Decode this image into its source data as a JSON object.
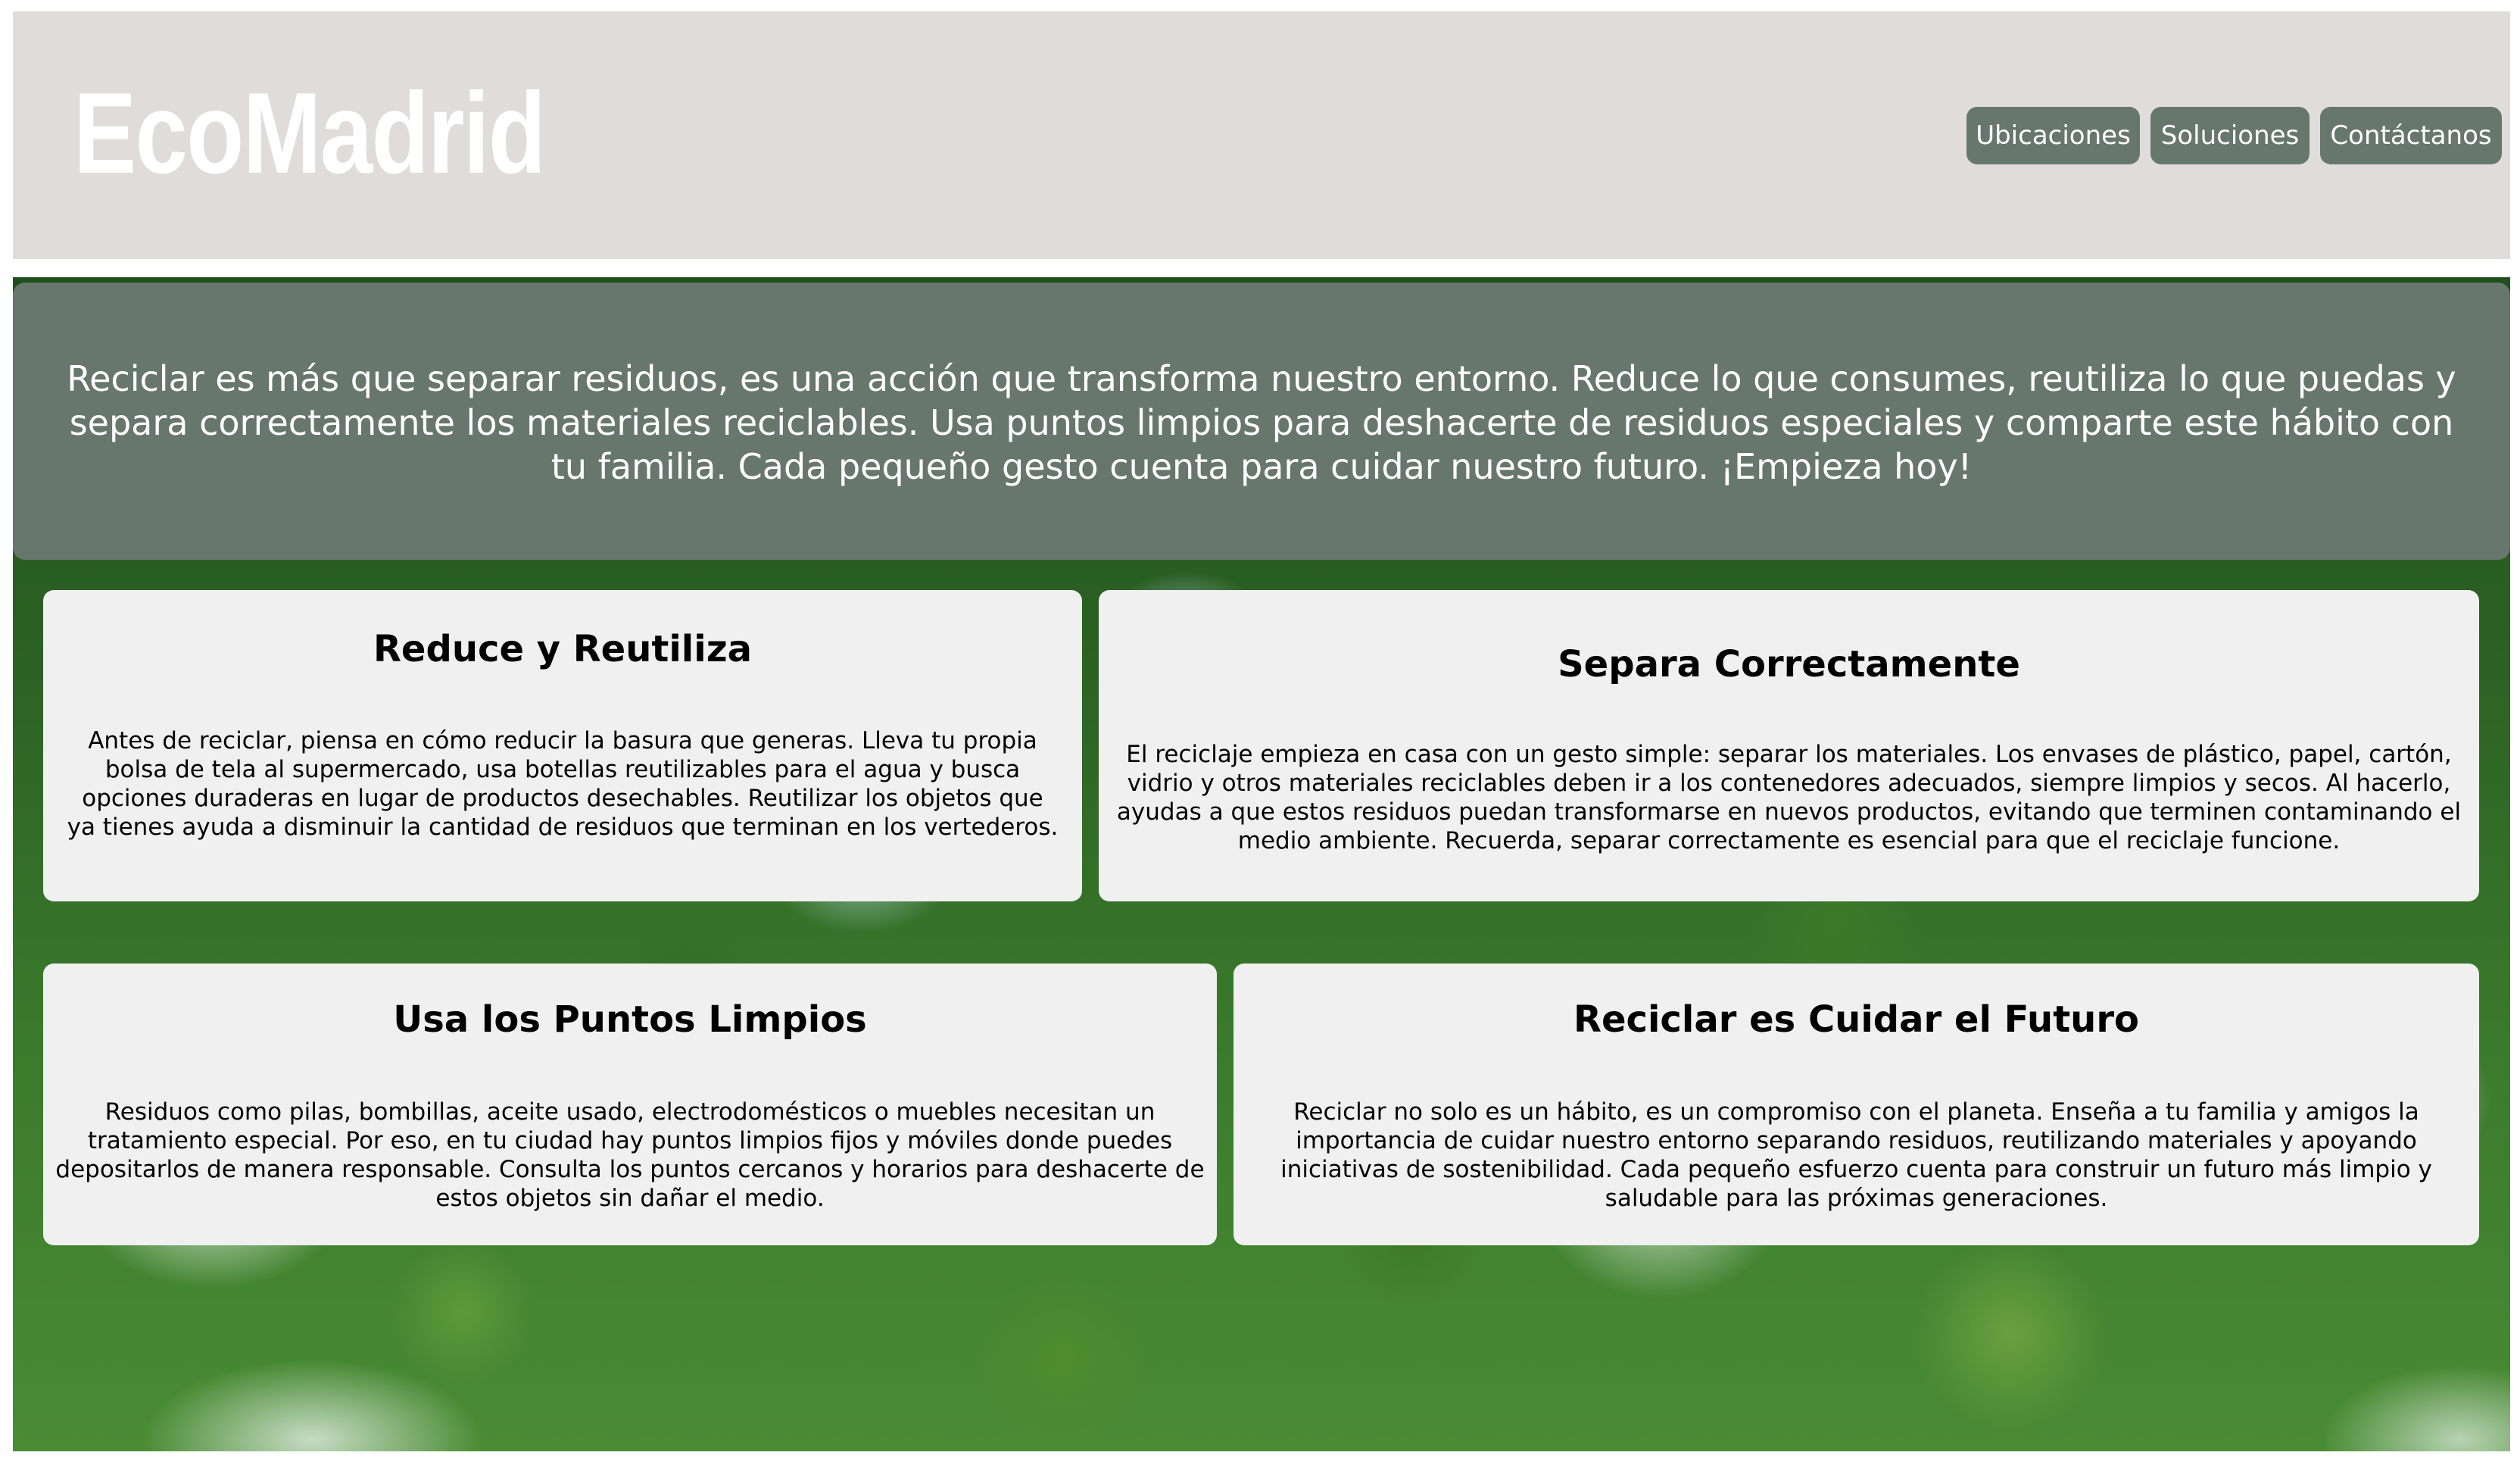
{
  "header": {
    "logo": "EcoMadrid",
    "nav": [
      {
        "label": "Ubicaciones"
      },
      {
        "label": "Soluciones"
      },
      {
        "label": "Contáctanos"
      }
    ]
  },
  "banner": {
    "text": "Reciclar es más que separar residuos, es una acción que transforma nuestro entorno. Reduce lo que consumes, reutiliza lo que puedas y separa correctamente los materiales reciclables. Usa puntos limpios para deshacerte de residuos especiales y comparte este hábito con tu familia. Cada pequeño gesto cuenta para cuidar nuestro futuro. ¡Empieza hoy!"
  },
  "cards": [
    {
      "title": "Reduce y Reutiliza",
      "text": "Antes de reciclar, piensa en cómo reducir la basura que generas. Lleva tu propia bolsa de tela al supermercado, usa botellas reutilizables para el agua y busca opciones duraderas en lugar de productos desechables. Reutilizar los objetos que ya tienes ayuda a disminuir la cantidad de residuos que terminan en los vertederos."
    },
    {
      "title": "Separa Correctamente",
      "text": "El reciclaje empieza en casa con un gesto simple: separar los materiales. Los envases de plástico, papel, cartón, vidrio y otros materiales reciclables deben ir a los contenedores adecuados, siempre limpios y secos. Al hacerlo, ayudas a que estos residuos puedan transformarse en nuevos productos, evitando que terminen contaminando el medio ambiente. Recuerda, separar correctamente es esencial para que el reciclaje funcione."
    },
    {
      "title": "Usa los Puntos Limpios",
      "text": "Residuos como pilas, bombillas, aceite usado, electrodomésticos o muebles necesitan un tratamiento especial. Por eso, en tu ciudad hay puntos limpios fijos y móviles donde puedes depositarlos de manera responsable. Consulta los puntos cercanos y horarios para deshacerte de estos objetos sin dañar el medio."
    },
    {
      "title": "Reciclar es Cuidar el Futuro",
      "text": "Reciclar no solo es un hábito, es un compromiso con el planeta. Enseña a tu familia y amigos la importancia de cuidar nuestro entorno separando residuos, reutilizando materiales y apoyando iniciativas de sostenibilidad. Cada pequeño esfuerzo cuenta para construir un futuro más limpio y saludable para las próximas generaciones."
    }
  ],
  "colors": {
    "header_bg": "#e1dcdc",
    "accent": "#67776d",
    "card_bg": "#f0f0f0"
  },
  "background_image": "aerial-forest-with-lake-and-clouds"
}
